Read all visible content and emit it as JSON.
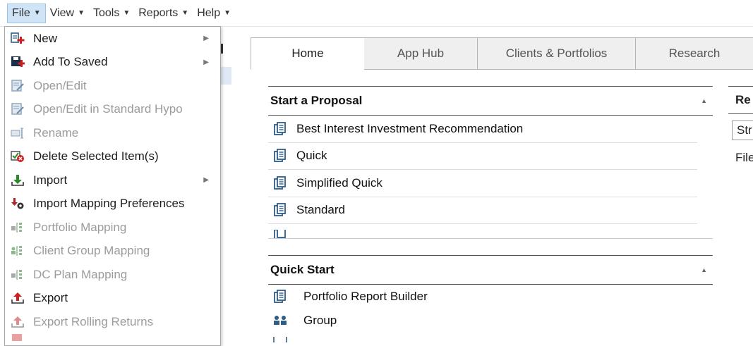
{
  "menubar": {
    "items": [
      {
        "label": "File"
      },
      {
        "label": "View"
      },
      {
        "label": "Tools"
      },
      {
        "label": "Reports"
      },
      {
        "label": "Help"
      }
    ]
  },
  "file_menu": {
    "items": [
      {
        "label": "New",
        "icon": "new-doc-plus-icon",
        "disabled": false,
        "submenu": true
      },
      {
        "label": "Add To Saved",
        "icon": "save-plus-icon",
        "disabled": false,
        "submenu": true
      },
      {
        "label": "Open/Edit",
        "icon": "edit-doc-icon",
        "disabled": true,
        "submenu": false
      },
      {
        "label": "Open/Edit in Standard Hypo",
        "icon": "edit-doc-icon",
        "disabled": true,
        "submenu": false
      },
      {
        "label": "Rename",
        "icon": "rename-icon",
        "disabled": true,
        "submenu": false
      },
      {
        "label": "Delete Selected Item(s)",
        "icon": "delete-icon",
        "disabled": false,
        "submenu": false
      },
      {
        "label": "Import",
        "icon": "import-arrow-icon",
        "disabled": false,
        "submenu": true
      },
      {
        "label": "Import Mapping Preferences",
        "icon": "import-gear-icon",
        "disabled": false,
        "submenu": false
      },
      {
        "label": "Portfolio Mapping",
        "icon": "mapping-icon",
        "disabled": true,
        "submenu": false
      },
      {
        "label": "Client Group Mapping",
        "icon": "group-mapping-icon",
        "disabled": true,
        "submenu": false
      },
      {
        "label": "DC Plan Mapping",
        "icon": "mapping-icon",
        "disabled": true,
        "submenu": false
      },
      {
        "label": "Export",
        "icon": "export-arrow-icon",
        "disabled": false,
        "submenu": false
      },
      {
        "label": "Export Rolling Returns",
        "icon": "export-arrow-icon",
        "disabled": true,
        "submenu": false
      }
    ]
  },
  "tabs": [
    {
      "label": "Home",
      "active": true
    },
    {
      "label": "App Hub",
      "active": false
    },
    {
      "label": "Clients & Portfolios",
      "active": false
    },
    {
      "label": "Research",
      "active": false
    }
  ],
  "start_proposal": {
    "title": "Start a Proposal",
    "items": [
      {
        "label": "Best Interest Investment Recommendation"
      },
      {
        "label": "Quick"
      },
      {
        "label": "Simplified Quick"
      },
      {
        "label": "Standard"
      }
    ]
  },
  "quick_start": {
    "title": "Quick Start",
    "items": [
      {
        "label": "Portfolio Report Builder",
        "icon": "report-doc-icon"
      },
      {
        "label": "Group",
        "icon": "people-icon"
      }
    ]
  },
  "right_panel": {
    "header": "Re",
    "field": "Str",
    "label": "File"
  },
  "colors": {
    "menu_active_bg": "#cfe4f7",
    "disabled_text": "#9b9b9b",
    "icon_blue": "#2f5d8a",
    "icon_red": "#cc2020",
    "icon_green": "#2a8a2a"
  }
}
